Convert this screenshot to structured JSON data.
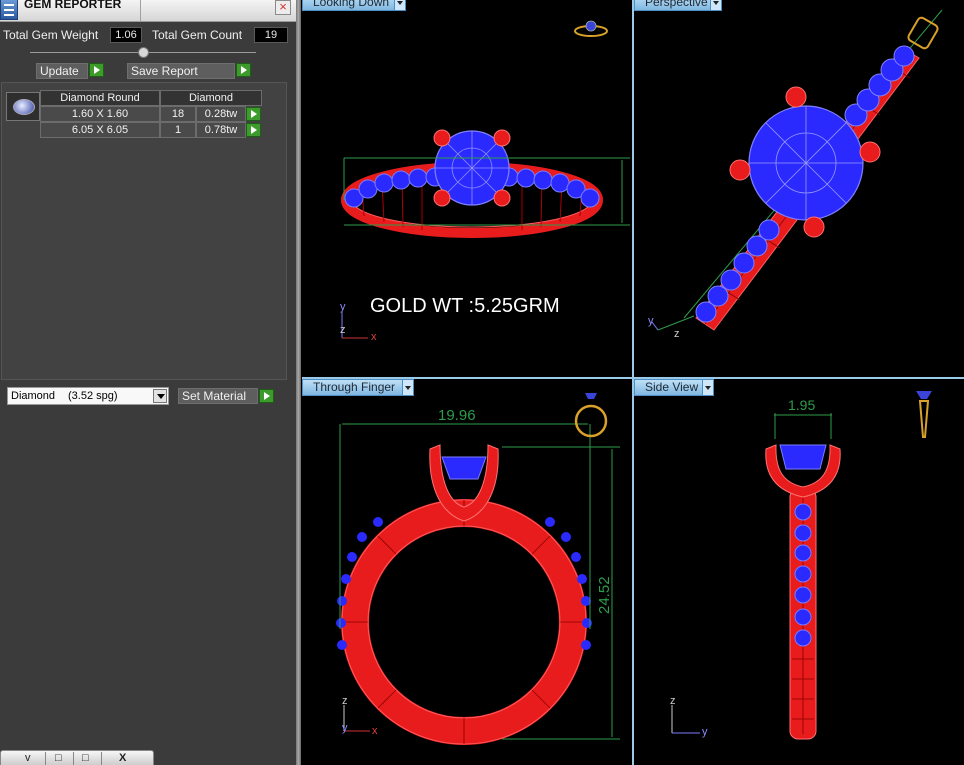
{
  "panel": {
    "title": "GEM REPORTER",
    "total_gem_weight_label": "Total Gem Weight",
    "total_gem_weight": "1.06",
    "total_gem_count_label": "Total Gem Count",
    "total_gem_count": "19",
    "update_label": "Update",
    "save_report_label": "Save Report",
    "table": {
      "shape_header": "Diamond Round",
      "material_header": "Diamond",
      "rows": [
        {
          "size": "1.60 X 1.60",
          "count": "18",
          "weight": "0.28tw"
        },
        {
          "size": "6.05 X 6.05",
          "count": "1",
          "weight": "0.78tw"
        }
      ]
    },
    "material_select": {
      "name": "Diamond",
      "spg": "(3.52 spg)"
    },
    "set_material_label": "Set Material"
  },
  "taskbar": {
    "buttons": [
      "v",
      "□",
      "□",
      "X"
    ]
  },
  "viewports": {
    "looking_down": {
      "label": "Looking Down",
      "annotation": "GOLD WT :5.25GRM",
      "axis_y": "y",
      "axis_z": "z",
      "axis_x": "x"
    },
    "perspective": {
      "label": "Perspective",
      "axis_y": "y",
      "axis_z": "z"
    },
    "through_finger": {
      "label": "Through Finger",
      "width_dim": "19.96",
      "height_dim": "24.52",
      "axis_z": "z",
      "axis_y": "y",
      "axis_x": "x"
    },
    "side_view": {
      "label": "Side View",
      "width_dim": "1.95",
      "axis_z": "z",
      "axis_y": "y"
    }
  },
  "colors": {
    "metal": "#e81c1c",
    "gem": "#2424ff",
    "dimension": "#2e9c4a",
    "viewport_border": "#9bc9e8"
  }
}
